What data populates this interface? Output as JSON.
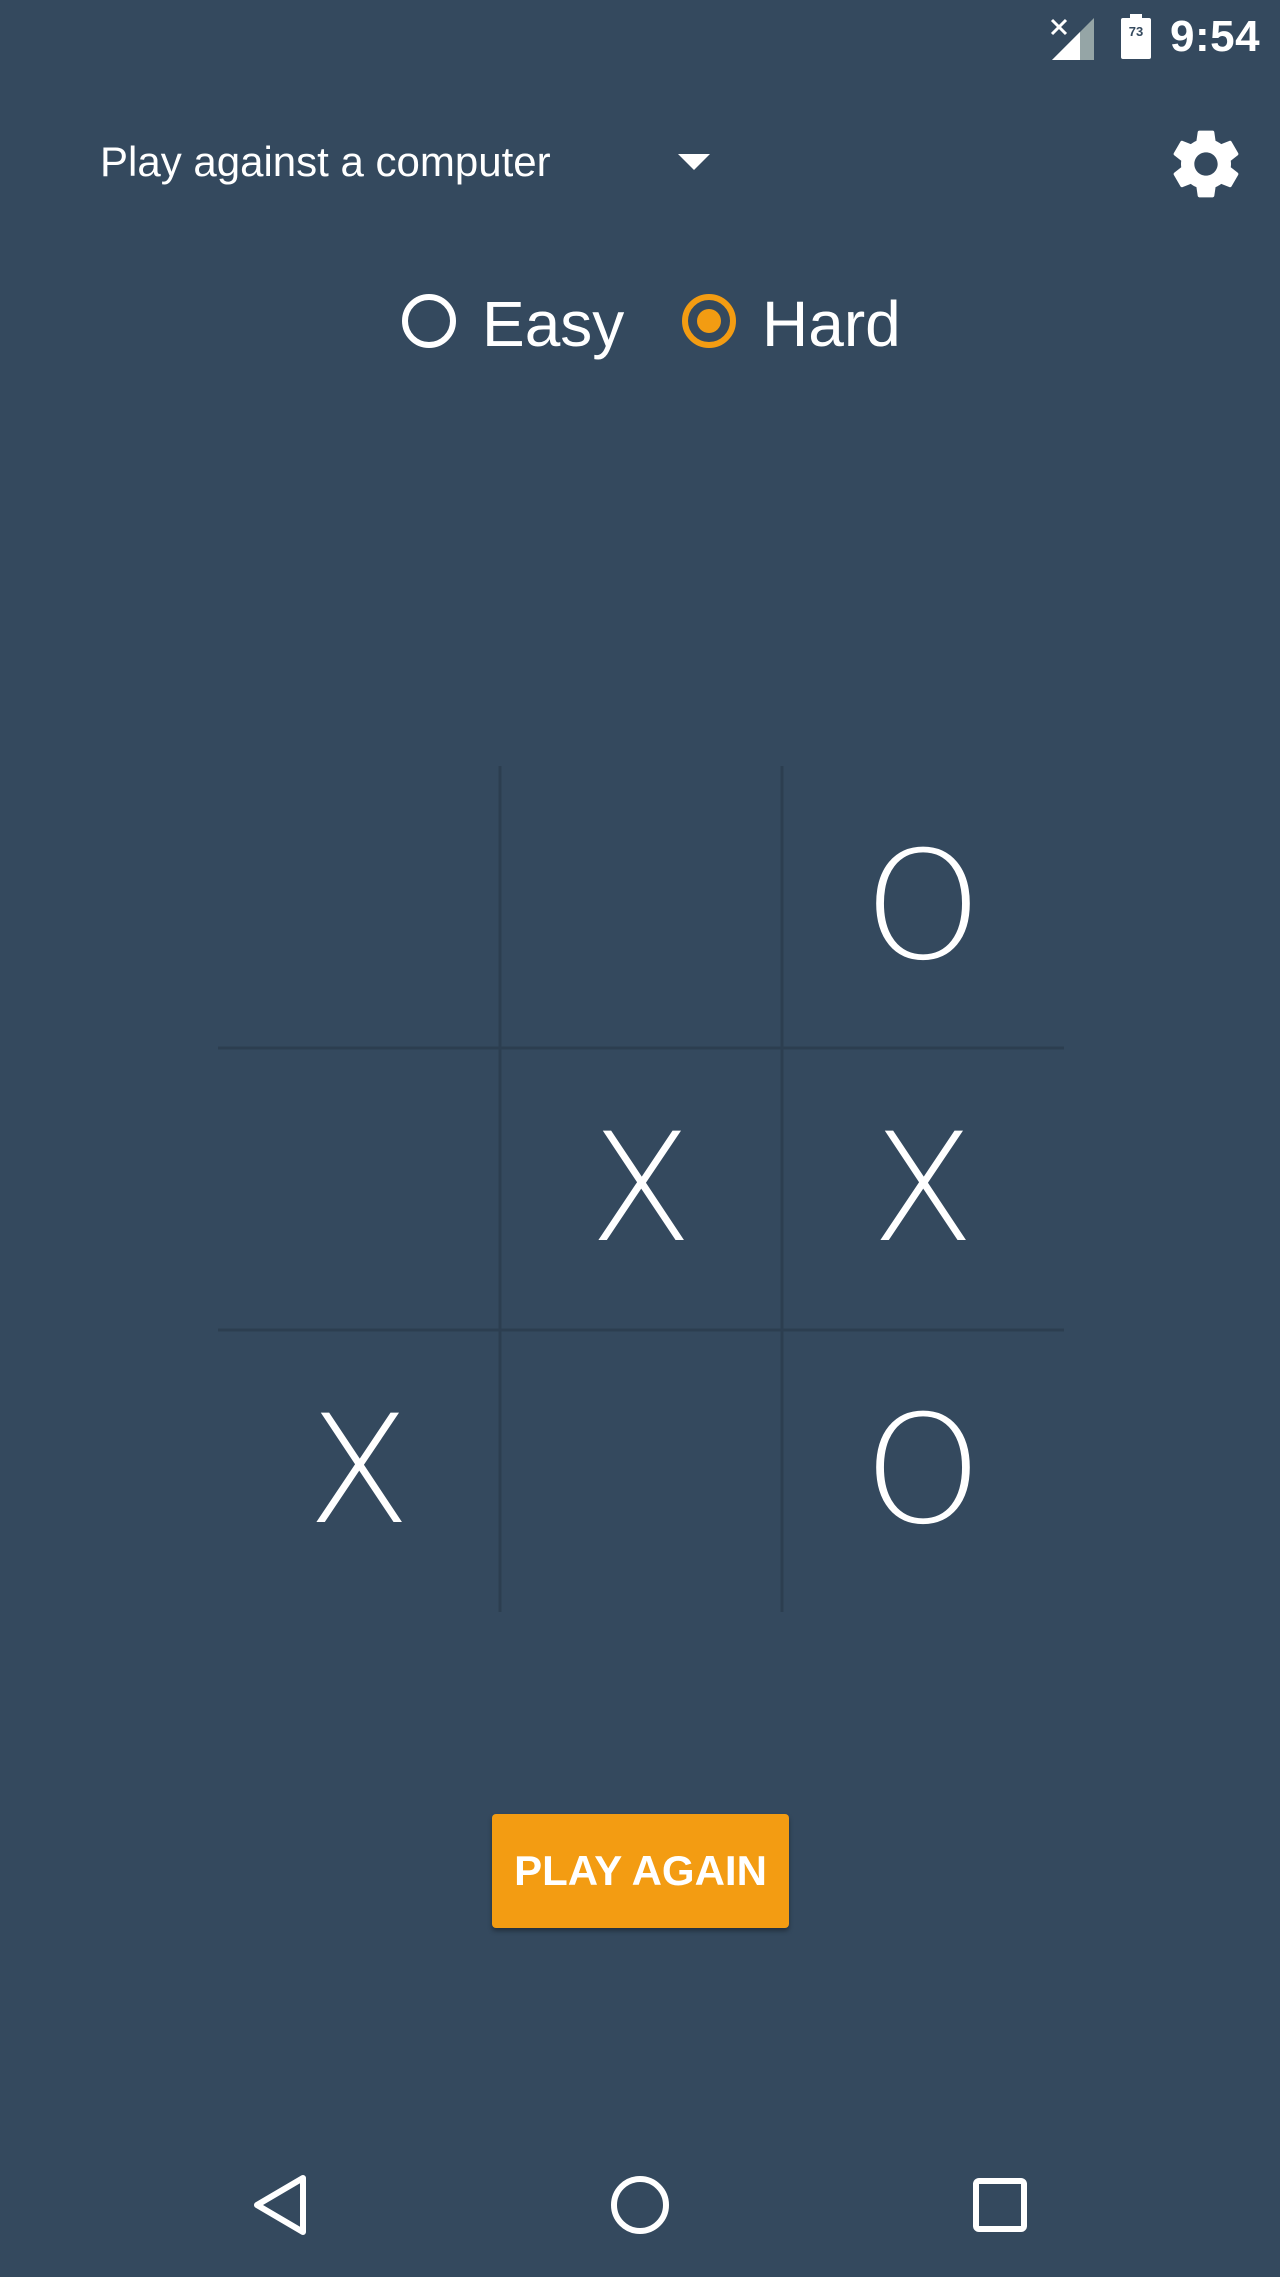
{
  "status_bar": {
    "time": "9:54",
    "battery_level": "73",
    "signal_icon": "signal-off-icon",
    "battery_icon": "battery-icon"
  },
  "header": {
    "mode_label": "Play against a computer",
    "dropdown_icon": "chevron-down-icon",
    "settings_icon": "gear-icon"
  },
  "difficulty": {
    "options": [
      {
        "label": "Easy",
        "selected": false
      },
      {
        "label": "Hard",
        "selected": true
      }
    ]
  },
  "board": {
    "cells": [
      "",
      "",
      "O",
      "",
      "X",
      "X",
      "X",
      "",
      "O"
    ]
  },
  "actions": {
    "play_again_label": "PLAY AGAIN"
  },
  "nav": {
    "back_icon": "back-icon",
    "home_icon": "home-icon",
    "recents_icon": "recents-icon"
  },
  "colors": {
    "background": "#34495e",
    "accent": "#f39c12",
    "grid_line": "#2c3e50",
    "text": "#ffffff"
  }
}
